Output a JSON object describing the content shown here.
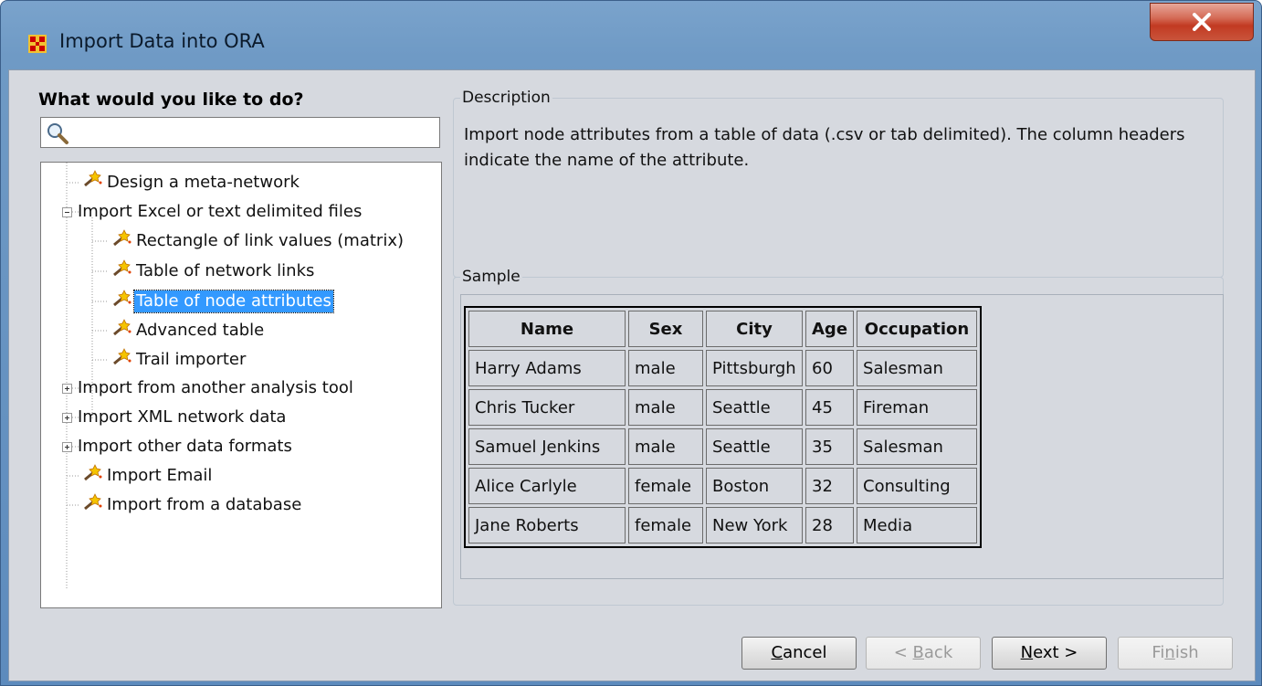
{
  "window": {
    "title": "Import Data into ORA"
  },
  "left_panel": {
    "heading": "What would you like to do?",
    "search": {
      "value": "",
      "placeholder": ""
    },
    "tree": [
      {
        "label": "Design a meta-network",
        "icon": "wand-icon",
        "level": 0
      },
      {
        "label": "Import Excel or text delimited files",
        "icon": "collapse-icon",
        "level": 0,
        "expanded": true
      },
      {
        "label": "Rectangle of link values (matrix)",
        "icon": "wand-icon",
        "level": 1
      },
      {
        "label": "Table of network links",
        "icon": "wand-icon",
        "level": 1
      },
      {
        "label": "Table of node attributes",
        "icon": "wand-icon",
        "level": 1,
        "selected": true
      },
      {
        "label": "Advanced table",
        "icon": "wand-icon",
        "level": 1
      },
      {
        "label": "Trail importer",
        "icon": "wand-icon",
        "level": 1
      },
      {
        "label": "Import from another analysis tool",
        "icon": "expand-icon",
        "level": 0,
        "expanded": false
      },
      {
        "label": "Import XML network data",
        "icon": "expand-icon",
        "level": 0,
        "expanded": false
      },
      {
        "label": "Import other data formats",
        "icon": "expand-icon",
        "level": 0,
        "expanded": false
      },
      {
        "label": "Import Email",
        "icon": "wand-icon",
        "level": 0
      },
      {
        "label": "Import from a database",
        "icon": "wand-icon",
        "level": 0
      }
    ]
  },
  "description": {
    "title": "Description",
    "text": "Import node attributes from a table of data (.csv or tab delimited). The column headers indicate the name of the attribute."
  },
  "sample": {
    "title": "Sample",
    "columns": [
      "Name",
      "Sex",
      "City",
      "Age",
      "Occupation"
    ],
    "rows": [
      [
        "Harry Adams",
        "male",
        "Pittsburgh",
        "60",
        "Salesman"
      ],
      [
        "Chris Tucker",
        "male",
        "Seattle",
        "45",
        "Fireman"
      ],
      [
        "Samuel Jenkins",
        "male",
        "Seattle",
        "35",
        "Salesman"
      ],
      [
        "Alice Carlyle",
        "female",
        "Boston",
        "32",
        "Consulting"
      ],
      [
        "Jane Roberts",
        "female",
        "New York",
        "28",
        "Media"
      ]
    ]
  },
  "buttons": {
    "cancel": {
      "label": "Cancel",
      "mnemonic": "C",
      "enabled": true
    },
    "back": {
      "label": "< Back",
      "mnemonic": "B",
      "enabled": false
    },
    "next": {
      "label": "Next >",
      "mnemonic": "N",
      "enabled": true
    },
    "finish": {
      "label": "Finish",
      "mnemonic": "n",
      "enabled": false
    }
  },
  "colors": {
    "selection": "#3399ff",
    "title_bar": "#6f9ac5",
    "close_button": "#c9543b",
    "panel": "#d6d9df"
  }
}
